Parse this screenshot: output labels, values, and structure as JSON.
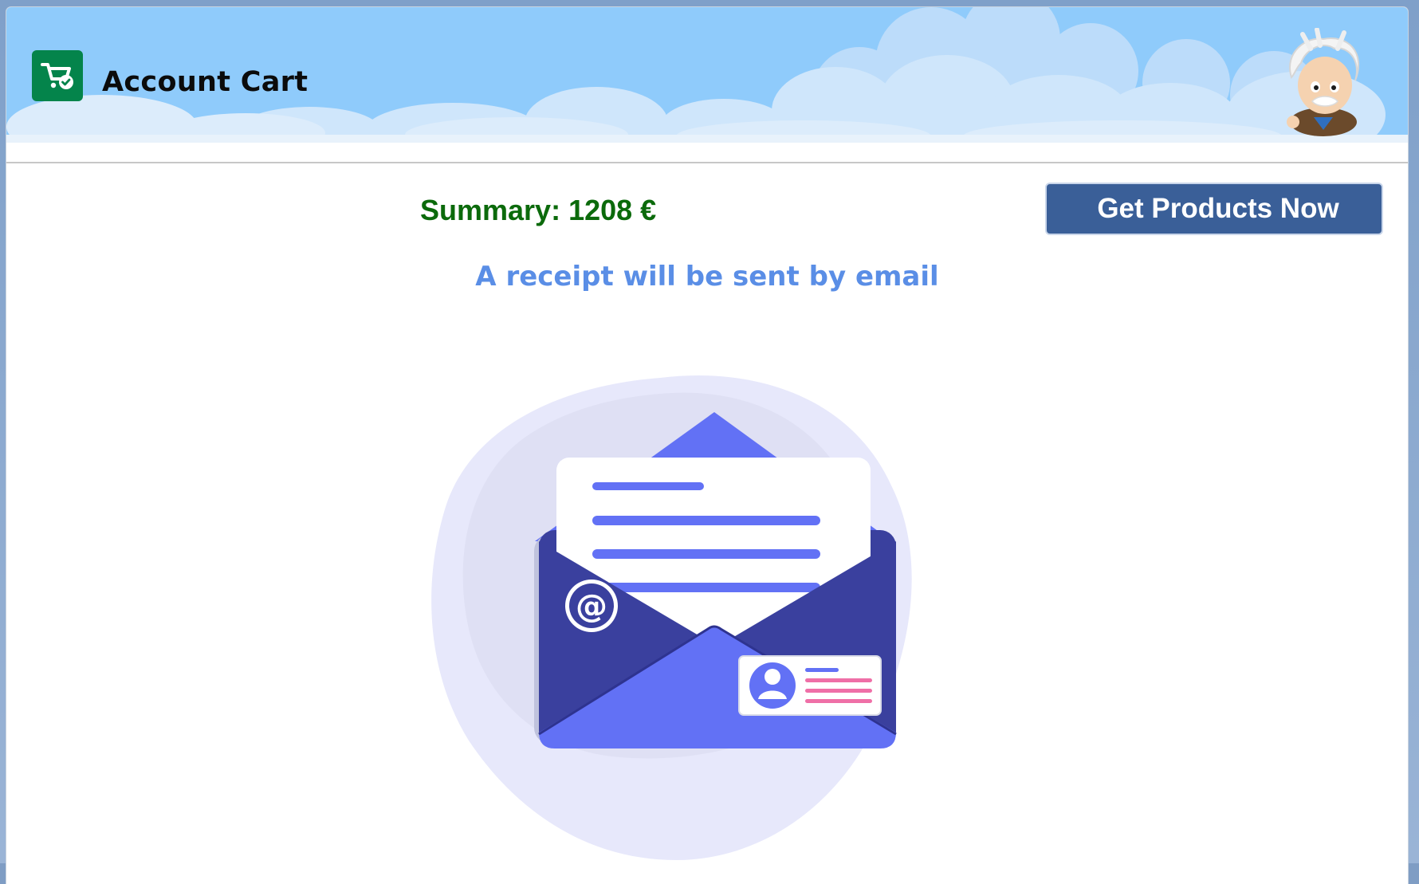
{
  "header": {
    "title": "Account Cart",
    "app_icon": "cart-check-icon",
    "mascot": "einstein-mascot"
  },
  "summary": {
    "label": "Summary: 1208 €"
  },
  "actions": {
    "get_products_label": "Get Products Now"
  },
  "message": {
    "receipt_text": "A receipt will be sent by email"
  },
  "illustration": {
    "icon": "email-envelope-illustration"
  },
  "colors": {
    "header_sky": "#8fcbfb",
    "app_icon_bg": "#04844b",
    "summary_text": "#0b6a0b",
    "button_bg": "#3a5f98",
    "receipt_text": "#5a8ee6",
    "envelope_dark": "#3a409e",
    "envelope_light": "#6271f5"
  }
}
